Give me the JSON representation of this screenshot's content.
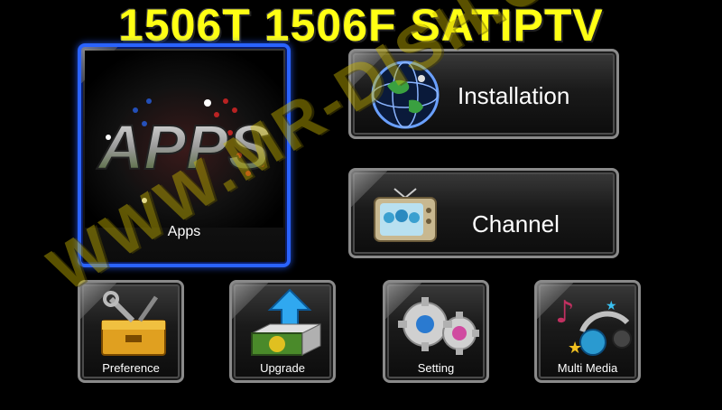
{
  "header": {
    "title": "1506T 1506F SATIPTV"
  },
  "tiles": {
    "apps": {
      "label": "Apps",
      "logo_text": "APPS"
    },
    "installation": {
      "label": "Installation"
    },
    "channel": {
      "label": "Channel"
    },
    "preference": {
      "label": "Preference"
    },
    "upgrade": {
      "label": "Upgrade"
    },
    "setting": {
      "label": "Setting"
    },
    "multimedia": {
      "label": "Multi Media"
    }
  },
  "watermark": {
    "text": "WWW.MR-DISH.COM"
  },
  "colors": {
    "title": "#ffff14",
    "selection_border": "#2a63ff",
    "watermark": "#c8b400"
  }
}
